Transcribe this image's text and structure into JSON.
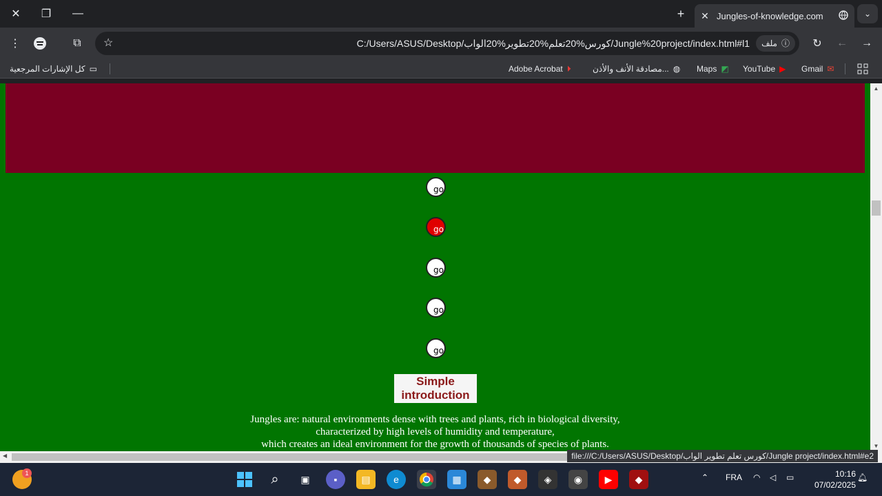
{
  "browser": {
    "tab_title": "Jungles-of-knowledge.com",
    "url": "C:/Users/ASUS/Desktop/كورس%20تعلم%20تطوير%20الواب/Jungle%20project/index.html#l1",
    "site_chip_label": "ملف",
    "new_tab_label": "+",
    "status_url": "file:///C:/Users/ASUS/Desktop/كورس تعلم تطوير الواب/Jungle project/index.html#e2"
  },
  "bookmarks": [
    {
      "label": "Gmail",
      "icon": "gmail-icon"
    },
    {
      "label": "YouTube",
      "icon": "youtube-icon"
    },
    {
      "label": "Maps",
      "icon": "maps-icon"
    },
    {
      "label": "مصادقة الأنف والأذن...",
      "icon": "globe-icon"
    },
    {
      "label": "Adobe Acrobat",
      "icon": "acrobat-icon"
    }
  ],
  "all_bookmarks_label": "كل الإشارات المرجعية",
  "page": {
    "nav_dots": [
      "go",
      "go",
      "go",
      "go",
      "go"
    ],
    "active_dot": 2,
    "intro_title": "Simple introduction",
    "intro_lines": [
      "Jungles are: natural environments dense with trees and plants, rich in biological diversity,",
      "characterized by high levels of humidity and temperature,",
      "which creates an ideal environment for the growth of thousands of species of plants."
    ]
  },
  "taskbar": {
    "weather_badge": "1",
    "language": "FRA",
    "time": "10:16",
    "date": "07/02/2025"
  },
  "colors": {
    "banner": "#7a0022",
    "page_bg": "#017501",
    "active_dot": "#e00000",
    "intro_text": "#8b1a1a"
  }
}
